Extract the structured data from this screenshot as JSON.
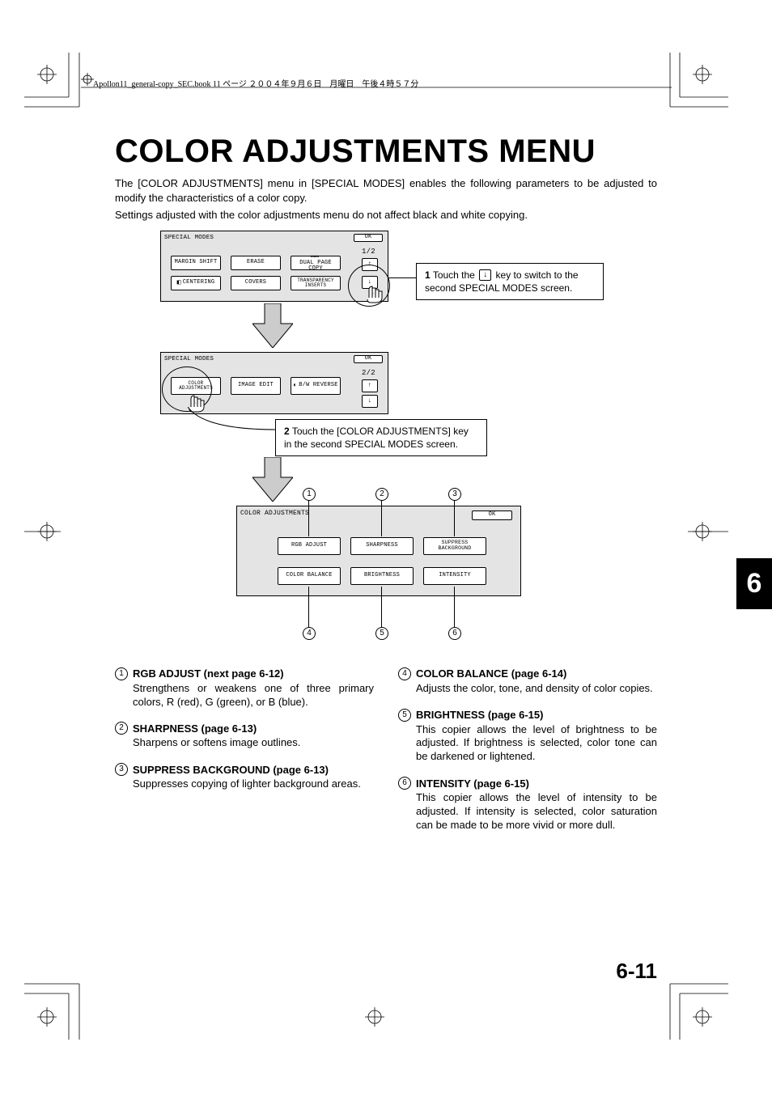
{
  "header_line": "Apollon11_general-copy_SEC.book  11 ページ  ２００４年９月６日　月曜日　午後４時５７分",
  "title": "COLOR ADJUSTMENTS MENU",
  "intro1": "The [COLOR ADJUSTMENTS] menu in [SPECIAL MODES] enables the following parameters to be adjusted to modify the characteristics of a color copy.",
  "intro2": "Settings adjusted with the color adjustments menu do not affect black and white copying.",
  "panel1": {
    "title": "SPECIAL MODES",
    "ok": "OK",
    "page": "1/2",
    "buttons": {
      "b1": "MARGIN SHIFT",
      "b2": "ERASE",
      "b3": "DUAL PAGE COPY",
      "b4": "CENTERING",
      "b5": "COVERS",
      "b6": "TRANSPARENCY INSERTS"
    }
  },
  "panel2": {
    "title": "SPECIAL MODES",
    "ok": "OK",
    "page": "2/2",
    "buttons": {
      "b1": "COLOR ADJUSTMENTS",
      "b2": "IMAGE EDIT",
      "b3": "B/W REVERSE"
    }
  },
  "panel3": {
    "title": "COLOR ADJUSTMENTS",
    "ok": "OK",
    "buttons": {
      "b1": "RGB ADJUST",
      "b2": "SHARPNESS",
      "b3": "SUPPRESS BACKGROUND",
      "b4": "COLOR BALANCE",
      "b5": "BRIGHTNESS",
      "b6": "INTENSITY"
    }
  },
  "callout1": {
    "num": "1",
    "text_before": "Touch the",
    "key": "↓",
    "text_after": "key to switch to the second SPECIAL MODES screen."
  },
  "callout2": {
    "num": "2",
    "text": "Touch the [COLOR ADJUSTMENTS] key in the second SPECIAL MODES screen."
  },
  "markers": {
    "m1": "1",
    "m2": "2",
    "m3": "3",
    "m4": "4",
    "m5": "5",
    "m6": "6"
  },
  "defs": {
    "d1": {
      "n": "1",
      "title": "RGB ADJUST (next page 6-12)",
      "body": "Strengthens or weakens one of three primary colors, R (red), G (green), or B (blue)."
    },
    "d2": {
      "n": "2",
      "title": "SHARPNESS (page 6-13)",
      "body": "Sharpens or softens image outlines."
    },
    "d3": {
      "n": "3",
      "title": "SUPPRESS BACKGROUND (page 6-13)",
      "body": "Suppresses copying of lighter background areas."
    },
    "d4": {
      "n": "4",
      "title": "COLOR BALANCE (page 6-14)",
      "body": "Adjusts the color, tone, and density of color copies."
    },
    "d5": {
      "n": "5",
      "title": "BRIGHTNESS (page 6-15)",
      "body": "This copier allows the level of brightness to be adjusted. If brightness is selected, color tone can be darkened or lightened."
    },
    "d6": {
      "n": "6",
      "title": "INTENSITY (page 6-15)",
      "body": "This copier allows the level of intensity to be adjusted. If intensity is selected, color saturation can be made to be more vivid or more dull."
    }
  },
  "tab": "6",
  "pagenum": "6-11"
}
